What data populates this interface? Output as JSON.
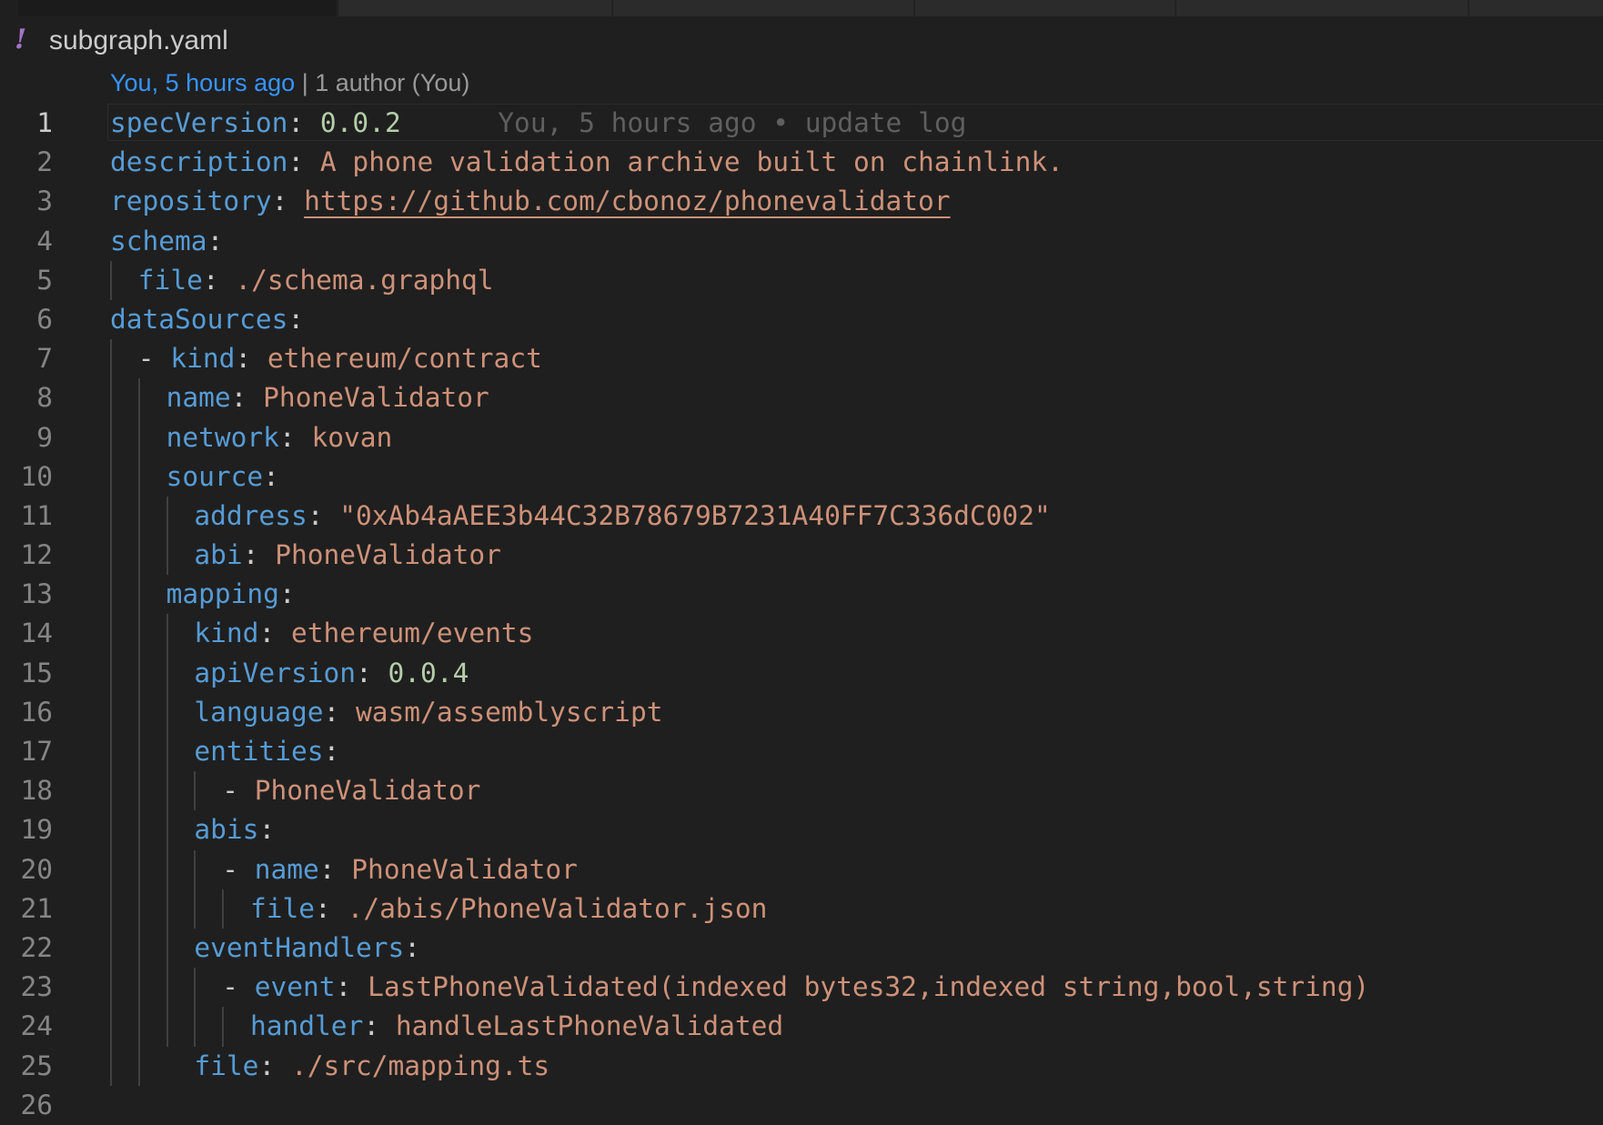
{
  "file": {
    "name": "subgraph.yaml",
    "icon": "yaml-exclamation-icon",
    "icon_glyph": "!"
  },
  "codelens": {
    "author_time": "You, 5 hours ago",
    "separator": " | ",
    "authors": "1 author (You)"
  },
  "blame": "You, 5 hours ago • update log",
  "colors": {
    "background": "#1f1f1f",
    "key": "#569cd6",
    "string": "#ce9178",
    "number": "#b5cea8",
    "line_number": "#858585"
  },
  "lines": [
    {
      "n": "1",
      "key": "specVersion",
      "sep": ": ",
      "val": "0.0.2"
    },
    {
      "n": "2",
      "key": "description",
      "sep": ": ",
      "val": "A phone validation archive built on chainlink."
    },
    {
      "n": "3",
      "key": "repository",
      "sep": ": ",
      "val": "https://github.com/cbonoz/phonevalidator"
    },
    {
      "n": "4",
      "key": "schema",
      "sep": ":"
    },
    {
      "n": "5",
      "key": "file",
      "sep": ": ",
      "val": "./schema.graphql"
    },
    {
      "n": "6",
      "key": "dataSources",
      "sep": ":"
    },
    {
      "n": "7",
      "dash": "- ",
      "key": "kind",
      "sep": ": ",
      "val": "ethereum/contract"
    },
    {
      "n": "8",
      "key": "name",
      "sep": ": ",
      "val": "PhoneValidator"
    },
    {
      "n": "9",
      "key": "network",
      "sep": ": ",
      "val": "kovan"
    },
    {
      "n": "10",
      "key": "source",
      "sep": ":"
    },
    {
      "n": "11",
      "key": "address",
      "sep": ": ",
      "val": "\"0xAb4aAEE3b44C32B78679B7231A40FF7C336dC002\""
    },
    {
      "n": "12",
      "key": "abi",
      "sep": ": ",
      "val": "PhoneValidator"
    },
    {
      "n": "13",
      "key": "mapping",
      "sep": ":"
    },
    {
      "n": "14",
      "key": "kind",
      "sep": ": ",
      "val": "ethereum/events"
    },
    {
      "n": "15",
      "key": "apiVersion",
      "sep": ": ",
      "val": "0.0.4"
    },
    {
      "n": "16",
      "key": "language",
      "sep": ": ",
      "val": "wasm/assemblyscript"
    },
    {
      "n": "17",
      "key": "entities",
      "sep": ":"
    },
    {
      "n": "18",
      "dash": "- ",
      "val": "PhoneValidator"
    },
    {
      "n": "19",
      "key": "abis",
      "sep": ":"
    },
    {
      "n": "20",
      "dash": "- ",
      "key": "name",
      "sep": ": ",
      "val": "PhoneValidator"
    },
    {
      "n": "21",
      "key": "file",
      "sep": ": ",
      "val": "./abis/PhoneValidator.json"
    },
    {
      "n": "22",
      "key": "eventHandlers",
      "sep": ":"
    },
    {
      "n": "23",
      "dash": "- ",
      "key": "event",
      "sep": ": ",
      "val": "LastPhoneValidated(indexed bytes32,indexed string,bool,string)"
    },
    {
      "n": "24",
      "key": "handler",
      "sep": ": ",
      "val": "handleLastPhoneValidated"
    },
    {
      "n": "25",
      "key": "file",
      "sep": ": ",
      "val": "./src/mapping.ts"
    },
    {
      "n": "26"
    }
  ]
}
